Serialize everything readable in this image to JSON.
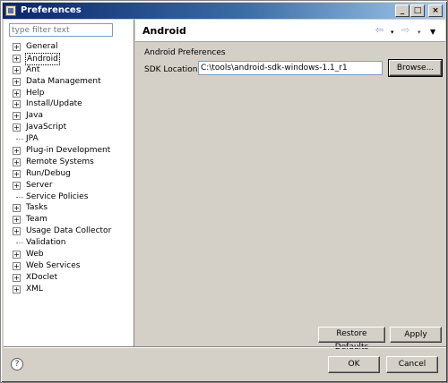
{
  "window": {
    "title": "Preferences",
    "controls": {
      "minimize": "_",
      "maximize": "□",
      "close": "×"
    }
  },
  "filter": {
    "placeholder": "type filter text"
  },
  "tree": [
    {
      "label": "General",
      "expandable": true
    },
    {
      "label": "Android",
      "expandable": true,
      "selected": true
    },
    {
      "label": "Ant",
      "expandable": true
    },
    {
      "label": "Data Management",
      "expandable": true
    },
    {
      "label": "Help",
      "expandable": true
    },
    {
      "label": "Install/Update",
      "expandable": true
    },
    {
      "label": "Java",
      "expandable": true
    },
    {
      "label": "JavaScript",
      "expandable": true
    },
    {
      "label": "JPA",
      "expandable": false
    },
    {
      "label": "Plug-in Development",
      "expandable": true
    },
    {
      "label": "Remote Systems",
      "expandable": true
    },
    {
      "label": "Run/Debug",
      "expandable": true
    },
    {
      "label": "Server",
      "expandable": true
    },
    {
      "label": "Service Policies",
      "expandable": false
    },
    {
      "label": "Tasks",
      "expandable": true
    },
    {
      "label": "Team",
      "expandable": true
    },
    {
      "label": "Usage Data Collector",
      "expandable": true
    },
    {
      "label": "Validation",
      "expandable": false
    },
    {
      "label": "Web",
      "expandable": true
    },
    {
      "label": "Web Services",
      "expandable": true
    },
    {
      "label": "XDoclet",
      "expandable": true
    },
    {
      "label": "XML",
      "expandable": true
    }
  ],
  "page": {
    "title": "Android",
    "section_label": "Android Preferences",
    "sdk_label": "SDK Location:",
    "sdk_value": "C:\\tools\\android-sdk-windows-1.1_r1",
    "browse_label": "Browse...",
    "restore_label": "Restore Defaults",
    "apply_label": "Apply"
  },
  "nav": {
    "back_icon": "⇦",
    "forward_icon": "⇨",
    "dropdown_icon": "▾",
    "menu_icon": "▼"
  },
  "footer": {
    "help_icon": "?",
    "ok_label": "OK",
    "cancel_label": "Cancel"
  }
}
